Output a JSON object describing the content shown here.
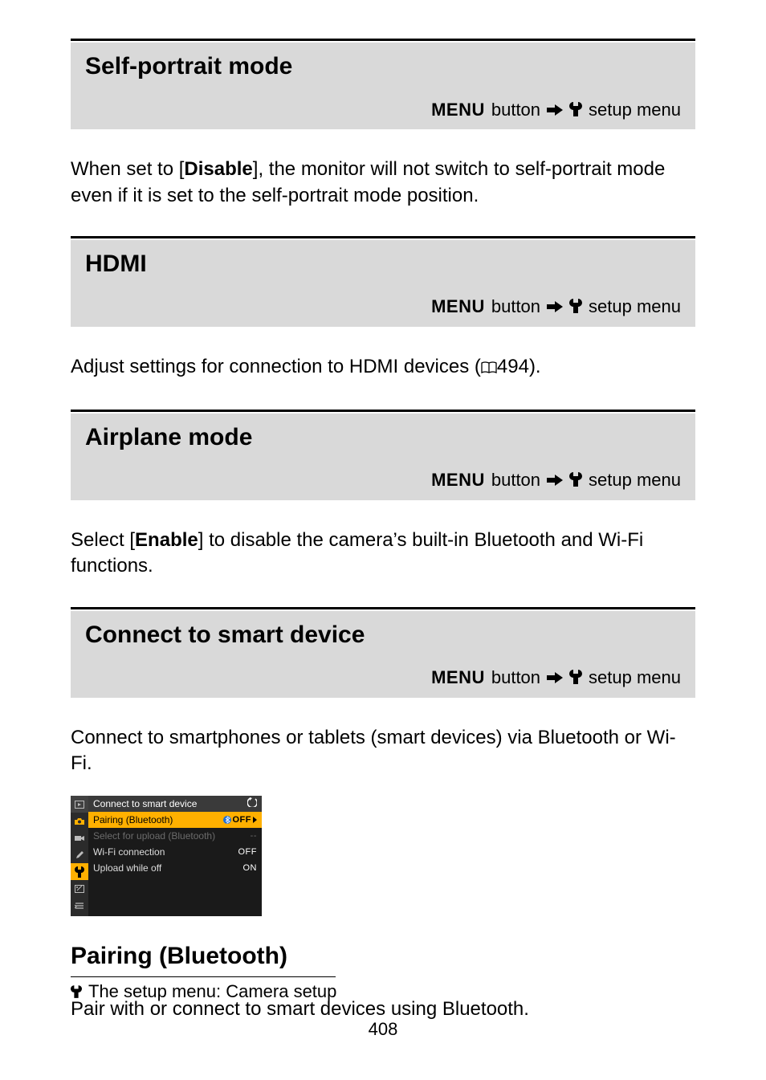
{
  "nav": {
    "menu_word": "MENU",
    "button_word": "button",
    "setup_menu": "setup menu"
  },
  "sections": {
    "self_portrait": {
      "title": "Self-portrait mode",
      "body_pre": "When set to [",
      "body_bold": "Disable",
      "body_post": "], the monitor will not switch to self-portrait mode even if it is set to the self-portrait mode position."
    },
    "hdmi": {
      "title": "HDMI",
      "body_pre": "Adjust settings for connection to HDMI devices (",
      "body_ref": "494",
      "body_post": ")."
    },
    "airplane": {
      "title": "Airplane mode",
      "body_pre": "Select [",
      "body_bold": "Enable",
      "body_post": "] to disable the camera’s built-in Bluetooth and Wi-Fi functions."
    },
    "connect": {
      "title": "Connect to smart device",
      "body": "Connect to smartphones or tablets (smart devices) via Bluetooth or Wi-Fi."
    }
  },
  "menu_shot": {
    "header": "Connect to smart device",
    "rows": {
      "r1": {
        "label": "Pairing (Bluetooth)",
        "val": "OFF"
      },
      "r2": {
        "label": "Select for upload (Bluetooth)",
        "val": "--"
      },
      "r3": {
        "label": "Wi-Fi connection",
        "val": "OFF"
      },
      "r4": {
        "label": "Upload while off",
        "val": "ON"
      }
    }
  },
  "pairing": {
    "title": "Pairing (Bluetooth)",
    "body": "Pair with or connect to smart devices using Bluetooth."
  },
  "footer": {
    "text": "The setup menu: Camera setup",
    "page": "408"
  }
}
